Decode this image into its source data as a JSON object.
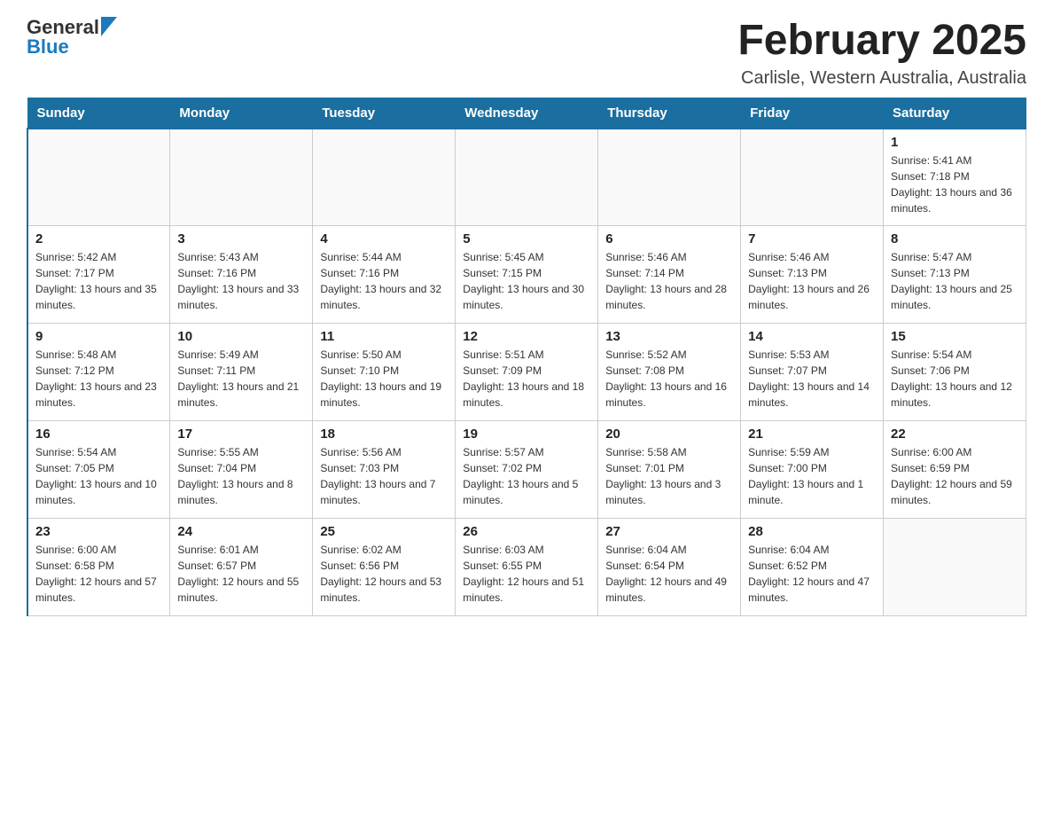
{
  "header": {
    "logo": {
      "general": "General",
      "blue": "Blue"
    },
    "title": "February 2025",
    "location": "Carlisle, Western Australia, Australia"
  },
  "days_of_week": [
    "Sunday",
    "Monday",
    "Tuesday",
    "Wednesday",
    "Thursday",
    "Friday",
    "Saturday"
  ],
  "weeks": [
    [
      {
        "day": "",
        "info": ""
      },
      {
        "day": "",
        "info": ""
      },
      {
        "day": "",
        "info": ""
      },
      {
        "day": "",
        "info": ""
      },
      {
        "day": "",
        "info": ""
      },
      {
        "day": "",
        "info": ""
      },
      {
        "day": "1",
        "info": "Sunrise: 5:41 AM\nSunset: 7:18 PM\nDaylight: 13 hours and 36 minutes."
      }
    ],
    [
      {
        "day": "2",
        "info": "Sunrise: 5:42 AM\nSunset: 7:17 PM\nDaylight: 13 hours and 35 minutes."
      },
      {
        "day": "3",
        "info": "Sunrise: 5:43 AM\nSunset: 7:16 PM\nDaylight: 13 hours and 33 minutes."
      },
      {
        "day": "4",
        "info": "Sunrise: 5:44 AM\nSunset: 7:16 PM\nDaylight: 13 hours and 32 minutes."
      },
      {
        "day": "5",
        "info": "Sunrise: 5:45 AM\nSunset: 7:15 PM\nDaylight: 13 hours and 30 minutes."
      },
      {
        "day": "6",
        "info": "Sunrise: 5:46 AM\nSunset: 7:14 PM\nDaylight: 13 hours and 28 minutes."
      },
      {
        "day": "7",
        "info": "Sunrise: 5:46 AM\nSunset: 7:13 PM\nDaylight: 13 hours and 26 minutes."
      },
      {
        "day": "8",
        "info": "Sunrise: 5:47 AM\nSunset: 7:13 PM\nDaylight: 13 hours and 25 minutes."
      }
    ],
    [
      {
        "day": "9",
        "info": "Sunrise: 5:48 AM\nSunset: 7:12 PM\nDaylight: 13 hours and 23 minutes."
      },
      {
        "day": "10",
        "info": "Sunrise: 5:49 AM\nSunset: 7:11 PM\nDaylight: 13 hours and 21 minutes."
      },
      {
        "day": "11",
        "info": "Sunrise: 5:50 AM\nSunset: 7:10 PM\nDaylight: 13 hours and 19 minutes."
      },
      {
        "day": "12",
        "info": "Sunrise: 5:51 AM\nSunset: 7:09 PM\nDaylight: 13 hours and 18 minutes."
      },
      {
        "day": "13",
        "info": "Sunrise: 5:52 AM\nSunset: 7:08 PM\nDaylight: 13 hours and 16 minutes."
      },
      {
        "day": "14",
        "info": "Sunrise: 5:53 AM\nSunset: 7:07 PM\nDaylight: 13 hours and 14 minutes."
      },
      {
        "day": "15",
        "info": "Sunrise: 5:54 AM\nSunset: 7:06 PM\nDaylight: 13 hours and 12 minutes."
      }
    ],
    [
      {
        "day": "16",
        "info": "Sunrise: 5:54 AM\nSunset: 7:05 PM\nDaylight: 13 hours and 10 minutes."
      },
      {
        "day": "17",
        "info": "Sunrise: 5:55 AM\nSunset: 7:04 PM\nDaylight: 13 hours and 8 minutes."
      },
      {
        "day": "18",
        "info": "Sunrise: 5:56 AM\nSunset: 7:03 PM\nDaylight: 13 hours and 7 minutes."
      },
      {
        "day": "19",
        "info": "Sunrise: 5:57 AM\nSunset: 7:02 PM\nDaylight: 13 hours and 5 minutes."
      },
      {
        "day": "20",
        "info": "Sunrise: 5:58 AM\nSunset: 7:01 PM\nDaylight: 13 hours and 3 minutes."
      },
      {
        "day": "21",
        "info": "Sunrise: 5:59 AM\nSunset: 7:00 PM\nDaylight: 13 hours and 1 minute."
      },
      {
        "day": "22",
        "info": "Sunrise: 6:00 AM\nSunset: 6:59 PM\nDaylight: 12 hours and 59 minutes."
      }
    ],
    [
      {
        "day": "23",
        "info": "Sunrise: 6:00 AM\nSunset: 6:58 PM\nDaylight: 12 hours and 57 minutes."
      },
      {
        "day": "24",
        "info": "Sunrise: 6:01 AM\nSunset: 6:57 PM\nDaylight: 12 hours and 55 minutes."
      },
      {
        "day": "25",
        "info": "Sunrise: 6:02 AM\nSunset: 6:56 PM\nDaylight: 12 hours and 53 minutes."
      },
      {
        "day": "26",
        "info": "Sunrise: 6:03 AM\nSunset: 6:55 PM\nDaylight: 12 hours and 51 minutes."
      },
      {
        "day": "27",
        "info": "Sunrise: 6:04 AM\nSunset: 6:54 PM\nDaylight: 12 hours and 49 minutes."
      },
      {
        "day": "28",
        "info": "Sunrise: 6:04 AM\nSunset: 6:52 PM\nDaylight: 12 hours and 47 minutes."
      },
      {
        "day": "",
        "info": ""
      }
    ]
  ]
}
